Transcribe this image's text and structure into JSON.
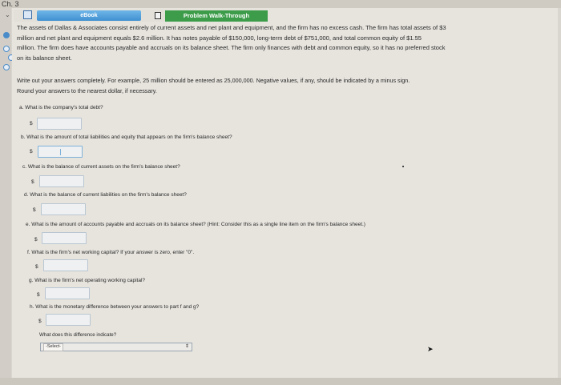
{
  "header": {
    "chapter_label": "Ch. 3"
  },
  "tabs": {
    "ebook_label": "eBook",
    "problem_walkthrough_label": "Problem Walk-Through"
  },
  "problem": {
    "intro_lines": [
      "The assets of Dallas & Associates consist entirely of current assets and net plant and equipment, and the firm has no excess cash. The firm has total assets of $3",
      "million and net plant and equipment equals $2.6 million. It has notes payable of $150,000, long-term debt of $751,000, and total common equity of $1.55",
      "million. The firm does have accounts payable and accruals on its balance sheet. The firm only finances with debt and common equity, so it has no preferred stock",
      "on its balance sheet."
    ],
    "instructions_lines": [
      "Write out your answers completely. For example, 25 million should be entered as 25,000,000. Negative values, if any, should be indicated by a minus sign.",
      "Round your answers to the nearest dollar, if necessary."
    ]
  },
  "questions": [
    {
      "text": "a. What is the company's total debt?",
      "currency": "$",
      "value": ""
    },
    {
      "text": "b. What is the amount of total liabilities and equity that appears on the firm's balance sheet?",
      "currency": "$",
      "value": ""
    },
    {
      "text": "c. What is the balance of current assets on the firm's balance sheet?",
      "currency": "$",
      "value": ""
    },
    {
      "text": "d. What is the balance of current liabilities on the firm's balance sheet?",
      "currency": "$",
      "value": ""
    },
    {
      "text": "e. What is the amount of accounts payable and accruals on its balance sheet? (Hint: Consider this as a single line item on the firm's balance sheet.)",
      "currency": "$",
      "value": ""
    },
    {
      "text": "f. What is the firm's net working capital? If your answer is zero, enter \"0\".",
      "currency": "$",
      "value": ""
    },
    {
      "text": "g. What is the firm's net operating working capital?",
      "currency": "$",
      "value": ""
    },
    {
      "text": "h. What is the monetary difference between your answers to part f and g?",
      "currency": "$",
      "value": ""
    }
  ],
  "difference_question": {
    "text": "What does this difference indicate?",
    "select_value": "-Select-",
    "arrow_icon": "up-down-arrow-icon"
  },
  "colors": {
    "ebook_tab": "#3f8fd1",
    "walkthrough_tab": "#3d9c4a",
    "radio": "#4a8cc9"
  }
}
